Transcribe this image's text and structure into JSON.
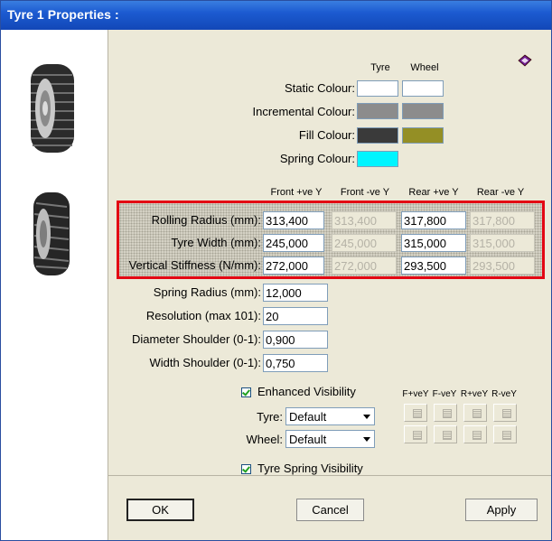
{
  "window": {
    "title": "Tyre 1 Properties :"
  },
  "colour_headers": {
    "tyre": "Tyre",
    "wheel": "Wheel"
  },
  "colour_rows": [
    {
      "label": "Static Colour:",
      "tyre": "#ffffff",
      "wheel": "#ffffff"
    },
    {
      "label": "Incremental Colour:",
      "tyre": "#8c8c8c",
      "wheel": "#8c8c8c"
    },
    {
      "label": "Fill Colour:",
      "tyre": "#3a3a3a",
      "wheel": "#948f25"
    },
    {
      "label": "Spring Colour:",
      "tyre": "#00f5ff"
    }
  ],
  "dir_headers": [
    "Front +ve Y",
    "Front -ve Y",
    "Rear +ve Y",
    "Rear -ve Y"
  ],
  "dim_rows": [
    {
      "label": "Rolling Radius (mm):",
      "values": [
        "313,400",
        "313,400",
        "317,800",
        "317,800"
      ]
    },
    {
      "label": "Tyre Width (mm):",
      "values": [
        "245,000",
        "245,000",
        "315,000",
        "315,000"
      ]
    },
    {
      "label": "Vertical Stiffness (N/mm):",
      "values": [
        "272,000",
        "272,000",
        "293,500",
        "293,500"
      ]
    }
  ],
  "single_rows": [
    {
      "label": "Spring Radius (mm):",
      "value": "12,000"
    },
    {
      "label": "Resolution (max 101):",
      "value": "20"
    },
    {
      "label": "Diameter Shoulder (0-1):",
      "value": "0,900"
    },
    {
      "label": "Width Shoulder (0-1):",
      "value": "0,750"
    }
  ],
  "enhanced_visibility": {
    "label": "Enhanced Visibility",
    "checked": true
  },
  "tyre_select": {
    "label": "Tyre:",
    "value": "Default"
  },
  "wheel_select": {
    "label": "Wheel:",
    "value": "Default"
  },
  "vis_headers": [
    "F+veY",
    "F-veY",
    "R+veY",
    "R-veY"
  ],
  "spring_visibility": {
    "label": "Tyre Spring Visibility",
    "checked": true
  },
  "buttons": {
    "ok": "OK",
    "cancel": "Cancel",
    "apply": "Apply"
  },
  "highlight_color": "#e30613",
  "icons": [
    "tyre-image-icon",
    "tyre-tread-image-icon",
    "help-book-icon"
  ]
}
